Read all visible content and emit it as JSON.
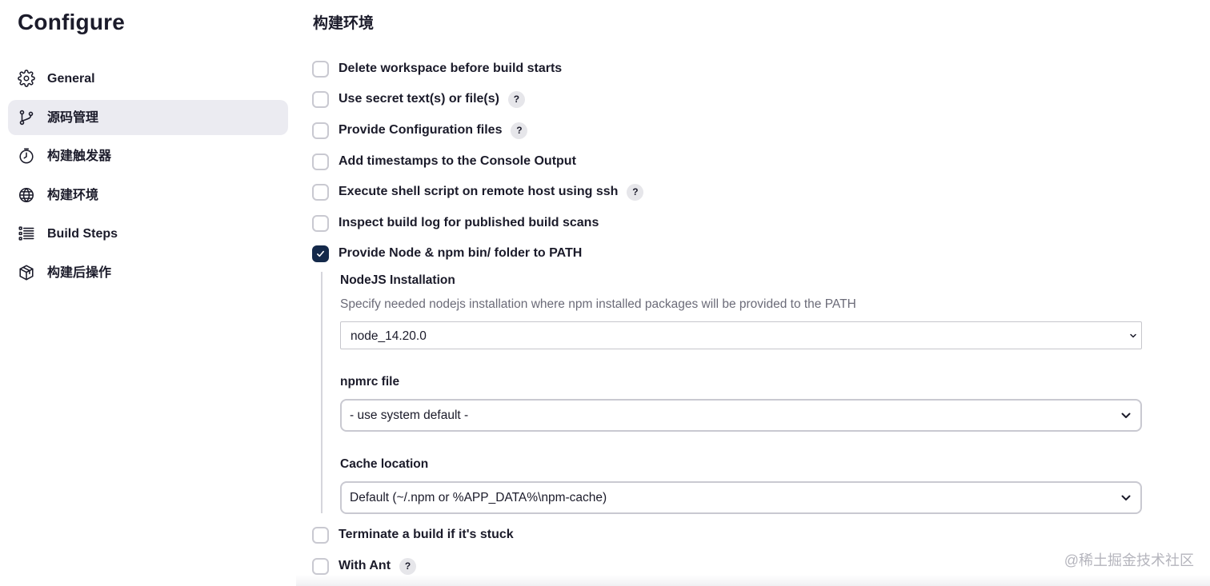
{
  "page": {
    "title": "Configure"
  },
  "sidebar": {
    "items": [
      {
        "label": "General",
        "icon": "gear-icon",
        "active": false
      },
      {
        "label": "源码管理",
        "icon": "branch-icon",
        "active": true
      },
      {
        "label": "构建触发器",
        "icon": "timer-icon",
        "active": false
      },
      {
        "label": "构建环境",
        "icon": "globe-icon",
        "active": false
      },
      {
        "label": "Build Steps",
        "icon": "list-icon",
        "active": false
      },
      {
        "label": "构建后操作",
        "icon": "package-icon",
        "active": false
      }
    ]
  },
  "main": {
    "section_title": "构建环境",
    "options": [
      {
        "label": "Delete workspace before build starts",
        "checked": false,
        "help": false
      },
      {
        "label": "Use secret text(s) or file(s)",
        "checked": false,
        "help": true
      },
      {
        "label": "Provide Configuration files",
        "checked": false,
        "help": true
      },
      {
        "label": "Add timestamps to the Console Output",
        "checked": false,
        "help": false
      },
      {
        "label": "Execute shell script on remote host using ssh",
        "checked": false,
        "help": true
      },
      {
        "label": "Inspect build log for published build scans",
        "checked": false,
        "help": false
      },
      {
        "label": "Provide Node & npm bin/ folder to PATH",
        "checked": true,
        "help": false
      },
      {
        "label": "Terminate a build if it's stuck",
        "checked": false,
        "help": false
      },
      {
        "label": "With Ant",
        "checked": false,
        "help": true
      }
    ],
    "help_symbol": "?",
    "nodejs": {
      "label": "NodeJS Installation",
      "description": "Specify needed nodejs installation where npm installed packages will be provided to the PATH",
      "selected": "node_14.20.0"
    },
    "npmrc": {
      "label": "npmrc file",
      "selected": "- use system default -"
    },
    "cache": {
      "label": "Cache location",
      "selected": "Default (~/.npm or %APP_DATA%\\npm-cache)"
    }
  },
  "watermark": "@稀土掘金技术社区",
  "colors": {
    "checkbox_checked": "#14294a",
    "active_nav_bg": "#ebebf1",
    "muted_text": "#6b6b78"
  }
}
